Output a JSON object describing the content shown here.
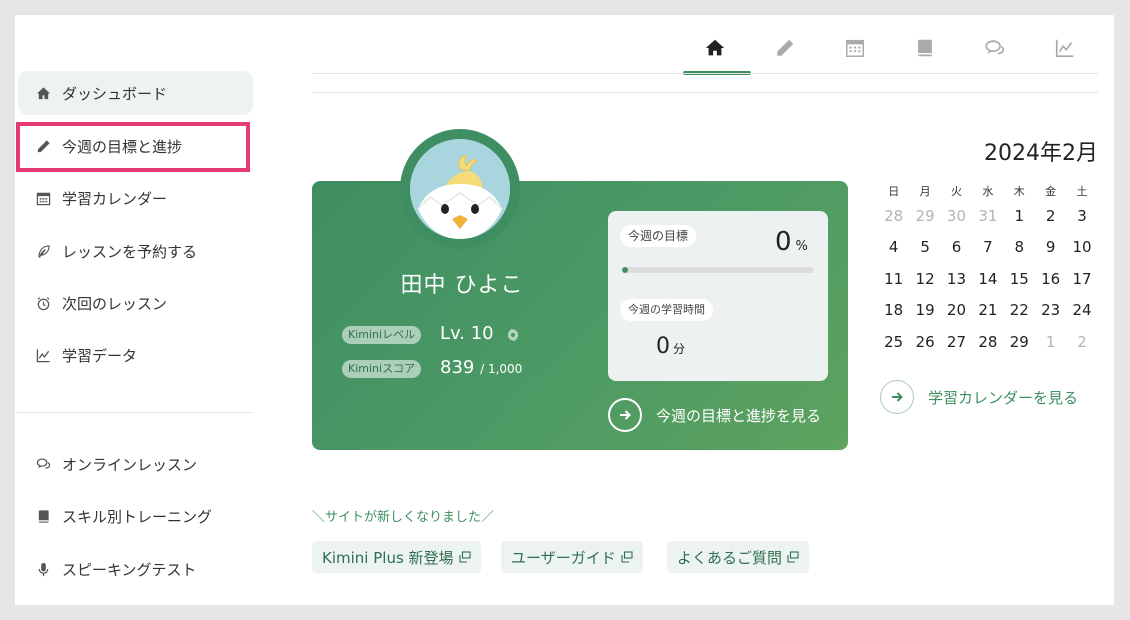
{
  "sidebar": {
    "items": [
      {
        "label": "ダッシュボード",
        "icon": "home-icon"
      },
      {
        "label": "今週の目標と進捗",
        "icon": "pencil-icon"
      },
      {
        "label": "学習カレンダー",
        "icon": "calendar-icon"
      },
      {
        "label": "レッスンを予約する",
        "icon": "feather-icon"
      },
      {
        "label": "次回のレッスン",
        "icon": "alarm-clock-icon"
      },
      {
        "label": "学習データ",
        "icon": "line-chart-icon"
      }
    ],
    "secondary": [
      {
        "label": "オンラインレッスン",
        "icon": "chat-bubbles-icon"
      },
      {
        "label": "スキル別トレーニング",
        "icon": "book-icon"
      },
      {
        "label": "スピーキングテスト",
        "icon": "microphone-icon"
      }
    ]
  },
  "topnav": {
    "icons": [
      "home-icon",
      "pencil-icon",
      "calendar-icon",
      "book-icon",
      "chat-bubbles-icon",
      "line-chart-icon"
    ],
    "active_index": 0
  },
  "profile": {
    "name": "田中 ひよこ",
    "level_label": "Kiminiレベル",
    "level_value": "Lv. 10",
    "score_label": "Kiminiスコア",
    "score_value": "839",
    "score_max": "/ 1,000"
  },
  "weekly": {
    "goal_label": "今週の目標",
    "goal_value": "0",
    "goal_unit": "%",
    "goal_progress": 0,
    "time_label": "今週の学習時間",
    "time_value": "0",
    "time_unit": "分",
    "link_label": "今週の目標と進捗を見る"
  },
  "calendar": {
    "title": "2024年2月",
    "weekdays": [
      "日",
      "月",
      "火",
      "水",
      "木",
      "金",
      "土"
    ],
    "weeks": [
      [
        {
          "d": "28",
          "m": true
        },
        {
          "d": "29",
          "m": true
        },
        {
          "d": "30",
          "m": true
        },
        {
          "d": "31",
          "m": true
        },
        {
          "d": "1"
        },
        {
          "d": "2"
        },
        {
          "d": "3"
        }
      ],
      [
        {
          "d": "4"
        },
        {
          "d": "5"
        },
        {
          "d": "6"
        },
        {
          "d": "7"
        },
        {
          "d": "8"
        },
        {
          "d": "9"
        },
        {
          "d": "10"
        }
      ],
      [
        {
          "d": "11"
        },
        {
          "d": "12"
        },
        {
          "d": "13"
        },
        {
          "d": "14"
        },
        {
          "d": "15"
        },
        {
          "d": "16"
        },
        {
          "d": "17"
        }
      ],
      [
        {
          "d": "18"
        },
        {
          "d": "19"
        },
        {
          "d": "20"
        },
        {
          "d": "21"
        },
        {
          "d": "22"
        },
        {
          "d": "23"
        },
        {
          "d": "24"
        }
      ],
      [
        {
          "d": "25"
        },
        {
          "d": "26"
        },
        {
          "d": "27"
        },
        {
          "d": "28"
        },
        {
          "d": "29"
        },
        {
          "d": "1",
          "m": true
        },
        {
          "d": "2",
          "m": true
        }
      ]
    ],
    "link_label": "学習カレンダーを見る"
  },
  "notices": {
    "label": "＼サイトが新しくなりました／",
    "links": [
      "Kimini Plus 新登場",
      "ユーザーガイド",
      "よくあるご質問"
    ]
  },
  "colors": {
    "accent": "#3f8f5f",
    "highlight": "#e63a78",
    "card_start": "#3e8e62",
    "card_end": "#5ea35e"
  }
}
